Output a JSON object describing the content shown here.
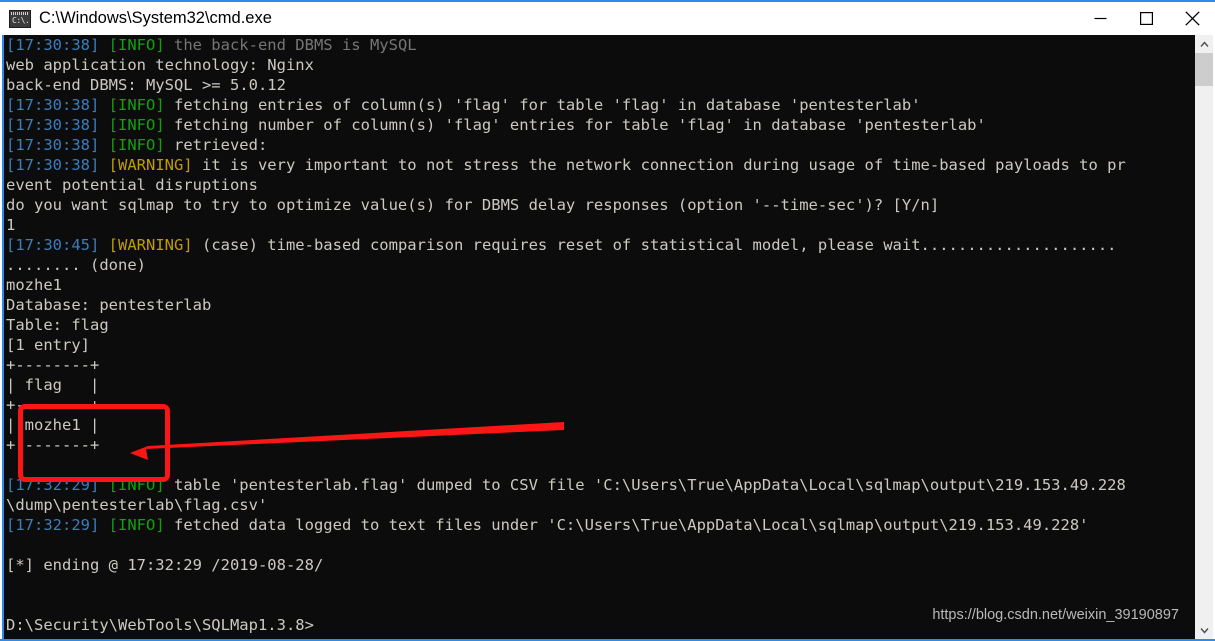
{
  "window": {
    "title": "C:\\Windows\\System32\\cmd.exe",
    "icon_label": "C:\\.",
    "icon_name": "cmd-window-icon",
    "accent_color": "#2d8ceb",
    "background_color": "#0c0c0c",
    "controls": {
      "minimize": "Minimize",
      "maximize": "Maximize",
      "close": "Close"
    }
  },
  "colors": {
    "timestamp": "#3a7ebf",
    "info": "#13a10e",
    "warning": "#c19c00",
    "text": "#ccc9c2",
    "dim": "#767676",
    "annotation": "#fb1616"
  },
  "console": {
    "lines": [
      {
        "id": "l1",
        "segments": [
          {
            "text": "[17:30:38] ",
            "cls": "c-time"
          },
          {
            "text": "[INFO] ",
            "cls": "c-info"
          },
          {
            "text": "the back-end DBMS is MySQL",
            "cls": "c-dim"
          }
        ]
      },
      {
        "id": "l2",
        "segments": [
          {
            "text": "web application technology: Nginx",
            "cls": "c-plain"
          }
        ]
      },
      {
        "id": "l3",
        "segments": [
          {
            "text": "back-end DBMS: MySQL >= 5.0.12",
            "cls": "c-plain"
          }
        ]
      },
      {
        "id": "l4",
        "segments": [
          {
            "text": "[17:30:38] ",
            "cls": "c-time"
          },
          {
            "text": "[INFO] ",
            "cls": "c-info"
          },
          {
            "text": "fetching entries of column(s) 'flag' for table 'flag' in database 'pentesterlab'",
            "cls": "c-plain"
          }
        ]
      },
      {
        "id": "l5",
        "segments": [
          {
            "text": "[17:30:38] ",
            "cls": "c-time"
          },
          {
            "text": "[INFO] ",
            "cls": "c-info"
          },
          {
            "text": "fetching number of column(s) 'flag' entries for table 'flag' in database 'pentesterlab'",
            "cls": "c-plain"
          }
        ]
      },
      {
        "id": "l6",
        "segments": [
          {
            "text": "[17:30:38] ",
            "cls": "c-time"
          },
          {
            "text": "[INFO] ",
            "cls": "c-info"
          },
          {
            "text": "retrieved:",
            "cls": "c-plain"
          }
        ]
      },
      {
        "id": "l7",
        "segments": [
          {
            "text": "[17:30:38] ",
            "cls": "c-time"
          },
          {
            "text": "[WARNING] ",
            "cls": "c-warn"
          },
          {
            "text": "it is very important to not stress the network connection during usage of time-based payloads to pr",
            "cls": "c-plain"
          }
        ]
      },
      {
        "id": "l8",
        "segments": [
          {
            "text": "event potential disruptions",
            "cls": "c-plain"
          }
        ]
      },
      {
        "id": "l9",
        "segments": [
          {
            "text": "do you want sqlmap to try to optimize value(s) for DBMS delay responses (option '--time-sec')? [Y/n]",
            "cls": "c-plain"
          }
        ]
      },
      {
        "id": "l10",
        "segments": [
          {
            "text": "1",
            "cls": "c-plain"
          }
        ]
      },
      {
        "id": "l11",
        "segments": [
          {
            "text": "[17:30:45] ",
            "cls": "c-time"
          },
          {
            "text": "[WARNING] ",
            "cls": "c-warn"
          },
          {
            "text": "(case) time-based comparison requires reset of statistical model, please wait.....................",
            "cls": "c-plain"
          }
        ]
      },
      {
        "id": "l12",
        "segments": [
          {
            "text": "........ (done)",
            "cls": "c-plain"
          }
        ]
      },
      {
        "id": "l13",
        "segments": [
          {
            "text": "mozhe1",
            "cls": "c-plain"
          }
        ]
      },
      {
        "id": "l14",
        "segments": [
          {
            "text": "Database: pentesterlab",
            "cls": "c-plain"
          }
        ]
      },
      {
        "id": "l15",
        "segments": [
          {
            "text": "Table: flag",
            "cls": "c-plain"
          }
        ]
      },
      {
        "id": "l16",
        "segments": [
          {
            "text": "[1 entry]",
            "cls": "c-plain"
          }
        ]
      },
      {
        "id": "l17",
        "segments": [
          {
            "text": "+--------+",
            "cls": "c-plain"
          }
        ]
      },
      {
        "id": "l18",
        "segments": [
          {
            "text": "| flag   |",
            "cls": "c-plain"
          }
        ]
      },
      {
        "id": "l19",
        "segments": [
          {
            "text": "+--------+",
            "cls": "c-plain"
          }
        ]
      },
      {
        "id": "l20",
        "segments": [
          {
            "text": "| mozhe1 |",
            "cls": "c-plain"
          }
        ]
      },
      {
        "id": "l21",
        "segments": [
          {
            "text": "+--------+",
            "cls": "c-plain"
          }
        ]
      },
      {
        "id": "l22",
        "segments": [
          {
            "text": "",
            "cls": "c-plain"
          }
        ]
      },
      {
        "id": "l23",
        "segments": [
          {
            "text": "[17:32:29] ",
            "cls": "c-time"
          },
          {
            "text": "[INFO] ",
            "cls": "c-info"
          },
          {
            "text": "table 'pentesterlab.flag' dumped to CSV file 'C:\\Users\\True\\AppData\\Local\\sqlmap\\output\\219.153.49.228",
            "cls": "c-plain"
          }
        ]
      },
      {
        "id": "l24",
        "segments": [
          {
            "text": "\\dump\\pentesterlab\\flag.csv'",
            "cls": "c-plain"
          }
        ]
      },
      {
        "id": "l25",
        "segments": [
          {
            "text": "[17:32:29] ",
            "cls": "c-time"
          },
          {
            "text": "[INFO] ",
            "cls": "c-info"
          },
          {
            "text": "fetched data logged to text files under 'C:\\Users\\True\\AppData\\Local\\sqlmap\\output\\219.153.49.228'",
            "cls": "c-plain"
          }
        ]
      },
      {
        "id": "l26",
        "segments": [
          {
            "text": "",
            "cls": "c-plain"
          }
        ]
      },
      {
        "id": "l27",
        "segments": [
          {
            "text": "[*] ending @ 17:32:29 /2019-08-28/",
            "cls": "c-plain"
          }
        ]
      },
      {
        "id": "l28",
        "segments": [
          {
            "text": "",
            "cls": "c-plain"
          }
        ]
      },
      {
        "id": "l29",
        "segments": [
          {
            "text": "",
            "cls": "c-plain"
          }
        ]
      },
      {
        "id": "l30",
        "segments": [
          {
            "text": "D:\\Security\\WebTools\\SQLMap1.3.8>",
            "cls": "c-plain"
          }
        ]
      }
    ]
  },
  "dumped_table": {
    "database": "pentesterlab",
    "table": "flag",
    "entry_count_label": "[1 entry]",
    "columns": [
      "flag"
    ],
    "rows": [
      [
        "mozhe1"
      ]
    ]
  },
  "annotation": {
    "box_label": "highlight-dumped-flag-value",
    "arrow_label": "pointer-to-flag-value",
    "color": "#fb1616"
  },
  "watermark": {
    "text": "https://blog.csdn.net/weixin_39190897"
  },
  "scrollbar": {
    "up_arrow": "▲",
    "down_arrow": "▼"
  }
}
